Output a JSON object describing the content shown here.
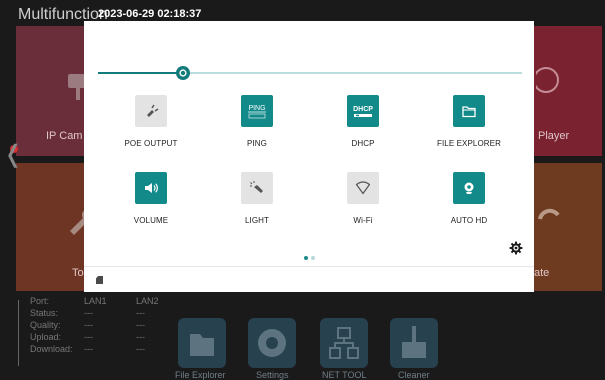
{
  "app": {
    "title": "Multifunction"
  },
  "status_bar": {
    "timestamp": "2023-06-29 02:18:37"
  },
  "background": {
    "tiles": [
      {
        "label": "IP Cam",
        "color": "#6a2e3a"
      },
      {
        "label": "Player",
        "color": "#7a2230"
      },
      {
        "label": "To",
        "color": "#6e3524"
      },
      {
        "label": "ate",
        "color": "#6e3a20"
      }
    ],
    "network": {
      "columns": [
        "Port:",
        "LAN1",
        "LAN2"
      ],
      "rows": [
        {
          "label": "Status:",
          "lan1": "---",
          "lan2": "---"
        },
        {
          "label": "Quality:",
          "lan1": "---",
          "lan2": "---"
        },
        {
          "label": "Upload:",
          "lan1": "---",
          "lan2": "---"
        },
        {
          "label": "Download:",
          "lan1": "---",
          "lan2": "---"
        }
      ]
    },
    "dock": [
      {
        "label": "File Explorer",
        "icon": "folder-icon"
      },
      {
        "label": "Settings",
        "icon": "gear-icon"
      },
      {
        "label": "NET TOOL",
        "icon": "network-icon"
      },
      {
        "label": "Cleaner",
        "icon": "broom-icon"
      }
    ]
  },
  "quick_settings": {
    "brightness": 0.2,
    "tiles": [
      {
        "label": "POE OUTPUT",
        "icon": "plug-icon",
        "active": false
      },
      {
        "label": "PING",
        "icon": "ping-icon",
        "active": true,
        "icon_text": "PING"
      },
      {
        "label": "DHCP",
        "icon": "dhcp-icon",
        "active": true,
        "icon_text": "DHCP"
      },
      {
        "label": "FILE EXPLORER",
        "icon": "folder-icon",
        "active": true
      },
      {
        "label": "VOLUME",
        "icon": "speaker-icon",
        "active": true
      },
      {
        "label": "LIGHT",
        "icon": "flashlight-icon",
        "active": false
      },
      {
        "label": "Wi-Fi",
        "icon": "wifi-icon",
        "active": false
      },
      {
        "label": "AUTO HD",
        "icon": "camera-icon",
        "active": true
      }
    ],
    "page": {
      "current": 1,
      "total": 2
    }
  },
  "colors": {
    "accent": "#138a8a",
    "inactive_tile": "#e3e3e3",
    "panel": "#ffffff"
  }
}
